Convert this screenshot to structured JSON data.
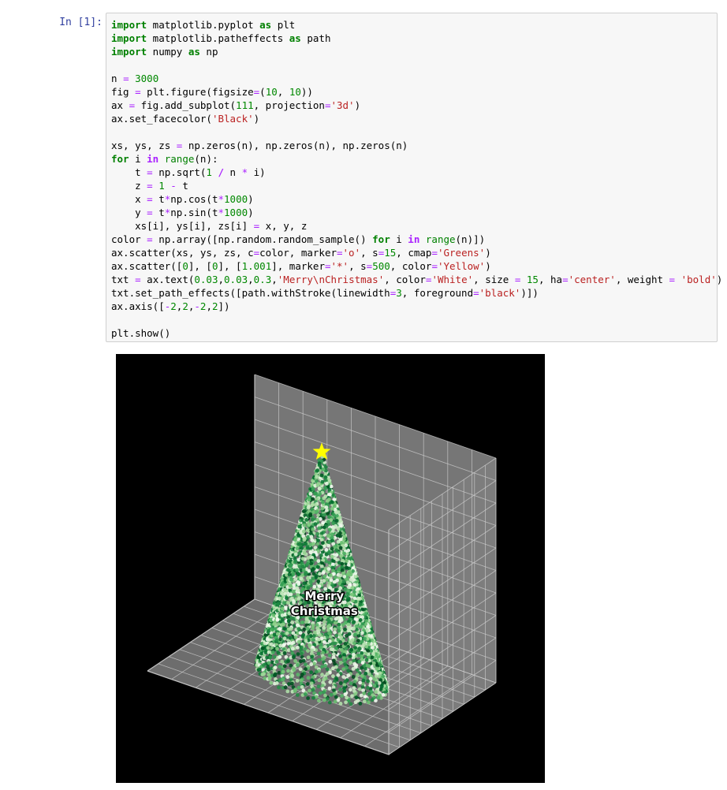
{
  "cell": {
    "prompt": "In [1]:",
    "code_lines": [
      [
        [
          "kw",
          "import"
        ],
        [
          "n",
          " matplotlib.pyplot "
        ],
        [
          "kw",
          "as"
        ],
        [
          "n",
          " plt"
        ]
      ],
      [
        [
          "kw",
          "import"
        ],
        [
          "n",
          " matplotlib.patheffects "
        ],
        [
          "kw",
          "as"
        ],
        [
          "n",
          " path"
        ]
      ],
      [
        [
          "kw",
          "import"
        ],
        [
          "n",
          " numpy "
        ],
        [
          "kw",
          "as"
        ],
        [
          "n",
          " np"
        ]
      ],
      [],
      [
        [
          "n",
          "n "
        ],
        [
          "o",
          "="
        ],
        [
          "n",
          " "
        ],
        [
          "num",
          "3000"
        ]
      ],
      [
        [
          "n",
          "fig "
        ],
        [
          "o",
          "="
        ],
        [
          "n",
          " plt.figure(figsize"
        ],
        [
          "o",
          "="
        ],
        [
          "n",
          "("
        ],
        [
          "num",
          "10"
        ],
        [
          "n",
          ", "
        ],
        [
          "num",
          "10"
        ],
        [
          "n",
          "))"
        ]
      ],
      [
        [
          "n",
          "ax "
        ],
        [
          "o",
          "="
        ],
        [
          "n",
          " fig.add_subplot("
        ],
        [
          "num",
          "111"
        ],
        [
          "n",
          ", projection"
        ],
        [
          "o",
          "="
        ],
        [
          "str",
          "'3d'"
        ],
        [
          "n",
          ")"
        ]
      ],
      [
        [
          "n",
          "ax.set_facecolor("
        ],
        [
          "str",
          "'Black'"
        ],
        [
          "n",
          ")"
        ]
      ],
      [],
      [
        [
          "n",
          "xs, ys, zs "
        ],
        [
          "o",
          "="
        ],
        [
          "n",
          " np.zeros(n), np.zeros(n), np.zeros(n)"
        ]
      ],
      [
        [
          "kw",
          "for"
        ],
        [
          "n",
          " i "
        ],
        [
          "op",
          "in"
        ],
        [
          "n",
          " "
        ],
        [
          "bi",
          "range"
        ],
        [
          "n",
          "(n):"
        ]
      ],
      [
        [
          "n",
          "    t "
        ],
        [
          "o",
          "="
        ],
        [
          "n",
          " np.sqrt("
        ],
        [
          "num",
          "1"
        ],
        [
          "n",
          " "
        ],
        [
          "op",
          "/"
        ],
        [
          "n",
          " n "
        ],
        [
          "o",
          "*"
        ],
        [
          "n",
          " i)"
        ]
      ],
      [
        [
          "n",
          "    z "
        ],
        [
          "o",
          "="
        ],
        [
          "n",
          " "
        ],
        [
          "num",
          "1"
        ],
        [
          "n",
          " "
        ],
        [
          "o",
          "-"
        ],
        [
          "n",
          " t"
        ]
      ],
      [
        [
          "n",
          "    x "
        ],
        [
          "o",
          "="
        ],
        [
          "n",
          " t"
        ],
        [
          "o",
          "*"
        ],
        [
          "n",
          "np.cos(t"
        ],
        [
          "o",
          "*"
        ],
        [
          "num",
          "1000"
        ],
        [
          "n",
          ")"
        ]
      ],
      [
        [
          "n",
          "    y "
        ],
        [
          "o",
          "="
        ],
        [
          "n",
          " t"
        ],
        [
          "o",
          "*"
        ],
        [
          "n",
          "np.sin(t"
        ],
        [
          "o",
          "*"
        ],
        [
          "num",
          "1000"
        ],
        [
          "n",
          ")"
        ]
      ],
      [
        [
          "n",
          "    xs[i], ys[i], zs[i] "
        ],
        [
          "o",
          "="
        ],
        [
          "n",
          " x, y, z"
        ]
      ],
      [
        [
          "n",
          "color "
        ],
        [
          "o",
          "="
        ],
        [
          "n",
          " np.array([np.random.random_sample() "
        ],
        [
          "kw",
          "for"
        ],
        [
          "n",
          " i "
        ],
        [
          "op",
          "in"
        ],
        [
          "n",
          " "
        ],
        [
          "bi",
          "range"
        ],
        [
          "n",
          "(n)])"
        ]
      ],
      [
        [
          "n",
          "ax.scatter(xs, ys, zs, c"
        ],
        [
          "o",
          "="
        ],
        [
          "n",
          "color, marker"
        ],
        [
          "o",
          "="
        ],
        [
          "str",
          "'o'"
        ],
        [
          "n",
          ", s"
        ],
        [
          "o",
          "="
        ],
        [
          "num",
          "15"
        ],
        [
          "n",
          ", cmap"
        ],
        [
          "o",
          "="
        ],
        [
          "str",
          "'Greens'"
        ],
        [
          "n",
          ")"
        ]
      ],
      [
        [
          "n",
          "ax.scatter(["
        ],
        [
          "num",
          "0"
        ],
        [
          "n",
          "], ["
        ],
        [
          "num",
          "0"
        ],
        [
          "n",
          "], ["
        ],
        [
          "num",
          "1.001"
        ],
        [
          "n",
          "], marker"
        ],
        [
          "o",
          "="
        ],
        [
          "str",
          "'*'"
        ],
        [
          "n",
          ", s"
        ],
        [
          "o",
          "="
        ],
        [
          "num",
          "500"
        ],
        [
          "n",
          ", color"
        ],
        [
          "o",
          "="
        ],
        [
          "str",
          "'Yellow'"
        ],
        [
          "n",
          ")"
        ]
      ],
      [
        [
          "n",
          "txt "
        ],
        [
          "o",
          "="
        ],
        [
          "n",
          " ax.text("
        ],
        [
          "num",
          "0.03"
        ],
        [
          "n",
          ","
        ],
        [
          "num",
          "0.03"
        ],
        [
          "n",
          ","
        ],
        [
          "num",
          "0.3"
        ],
        [
          "n",
          ","
        ],
        [
          "str",
          "'Merry\\nChristmas'"
        ],
        [
          "n",
          ", color"
        ],
        [
          "o",
          "="
        ],
        [
          "str",
          "'White'"
        ],
        [
          "n",
          ", size "
        ],
        [
          "o",
          "="
        ],
        [
          "n",
          " "
        ],
        [
          "num",
          "15"
        ],
        [
          "n",
          ", ha"
        ],
        [
          "o",
          "="
        ],
        [
          "str",
          "'center'"
        ],
        [
          "n",
          ", weight "
        ],
        [
          "o",
          "="
        ],
        [
          "n",
          " "
        ],
        [
          "str",
          "'bold'"
        ],
        [
          "n",
          ")"
        ]
      ],
      [
        [
          "n",
          "txt.set_path_effects([path.withStroke(linewidth"
        ],
        [
          "o",
          "="
        ],
        [
          "num",
          "3"
        ],
        [
          "n",
          ", foreground"
        ],
        [
          "o",
          "="
        ],
        [
          "str",
          "'black'"
        ],
        [
          "n",
          ")])"
        ]
      ],
      [
        [
          "n",
          "ax.axis(["
        ],
        [
          "o",
          "-"
        ],
        [
          "num",
          "2"
        ],
        [
          "n",
          ","
        ],
        [
          "num",
          "2"
        ],
        [
          "n",
          ","
        ],
        [
          "o",
          "-"
        ],
        [
          "num",
          "2"
        ],
        [
          "n",
          ","
        ],
        [
          "num",
          "2"
        ],
        [
          "n",
          "])"
        ]
      ],
      [],
      [
        [
          "n",
          "plt.show()"
        ]
      ]
    ]
  },
  "chart_data": {
    "type": "scatter",
    "projection": "3d",
    "facecolor": "#000000",
    "pane_color": "#808080",
    "grid": true,
    "xlim": [
      -2,
      2
    ],
    "ylim": [
      -2,
      2
    ],
    "zlim": [
      0,
      1
    ],
    "series": [
      {
        "kind": "cone-spiral",
        "n": 3000,
        "marker": "o",
        "cmap": "Greens",
        "x_formula": "t*cos(t*1000)",
        "y_formula": "t*sin(t*1000)",
        "z_formula": "1 - t",
        "t_formula": "sqrt(i / n)"
      },
      {
        "kind": "star",
        "x": [
          0
        ],
        "y": [
          0
        ],
        "z": [
          1.001
        ],
        "marker": "*",
        "color": "#ffff00"
      }
    ],
    "text": {
      "lines": [
        "Merry",
        "Christmas"
      ],
      "x": 0.03,
      "y": 0.03,
      "z": 0.3,
      "color": "#ffffff",
      "stroke": "#000000"
    }
  }
}
